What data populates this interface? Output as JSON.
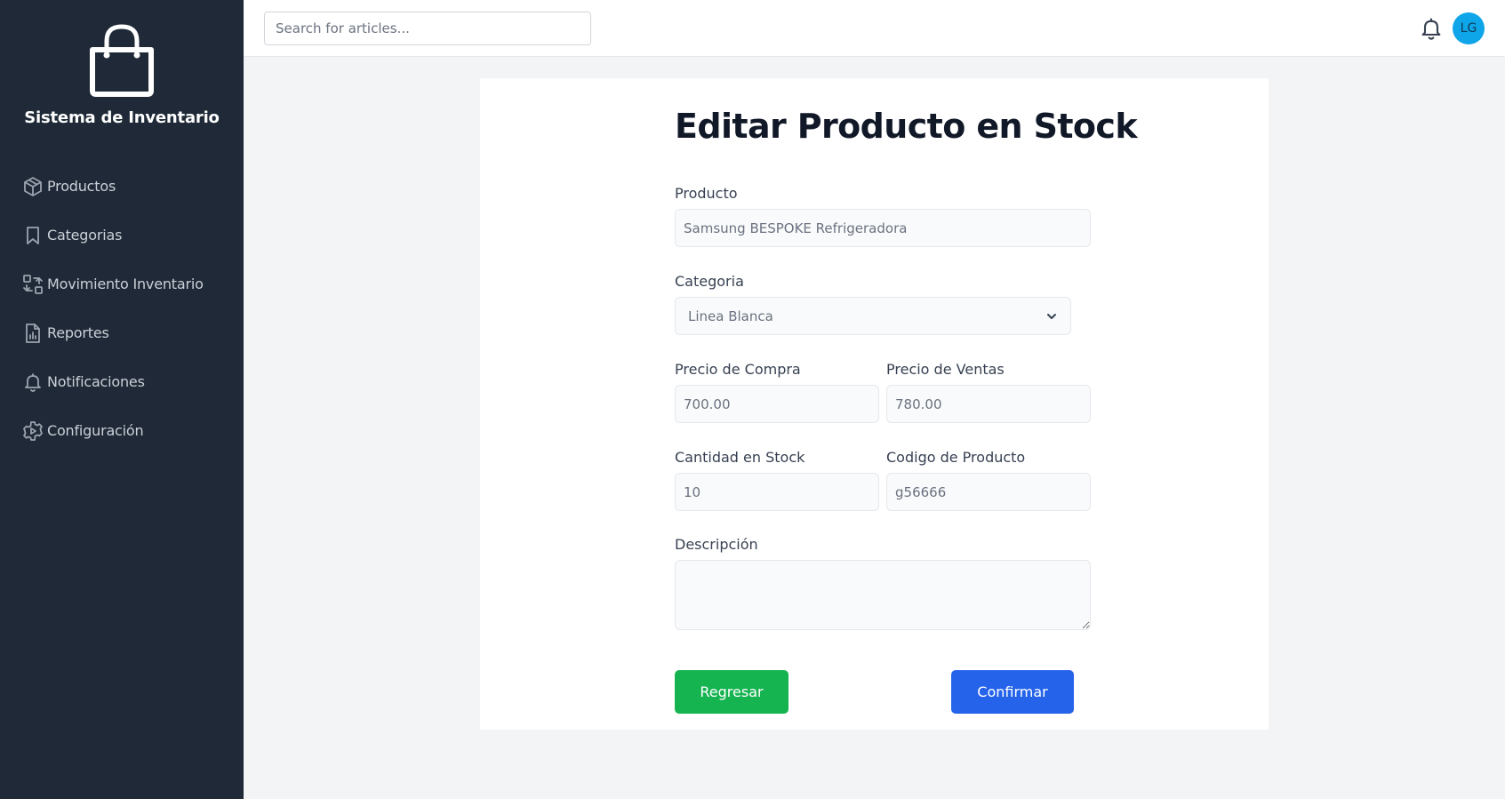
{
  "sidebar": {
    "brand_title": "Sistema de Inventario",
    "brand_icon": "shopping-bag-icon",
    "items": [
      {
        "label": "Productos",
        "icon": "cube-icon"
      },
      {
        "label": "Categorias",
        "icon": "bookmark-icon"
      },
      {
        "label": "Movimiento Inventario",
        "icon": "arrows-exchange-icon"
      },
      {
        "label": "Reportes",
        "icon": "report-file-icon"
      },
      {
        "label": "Notificaciones",
        "icon": "bell-icon"
      },
      {
        "label": "Configuración",
        "icon": "gear-icon"
      }
    ]
  },
  "topbar": {
    "search_placeholder": "Search for articles...",
    "avatar_initials": "LG"
  },
  "form": {
    "title": "Editar Producto en Stock",
    "producto_label": "Producto",
    "producto_value": "Samsung BESPOKE Refrigeradora",
    "categoria_label": "Categoria",
    "categoria_value": "Linea Blanca",
    "precio_compra_label": "Precio de Compra",
    "precio_compra_value": "700.00",
    "precio_ventas_label": "Precio de Ventas",
    "precio_ventas_value": "780.00",
    "cantidad_label": "Cantidad en Stock",
    "cantidad_value": "10",
    "codigo_label": "Codigo de Producto",
    "codigo_value": "g56666",
    "descripcion_label": "Descripción",
    "descripcion_value": "",
    "back_label": "Regresar",
    "confirm_label": "Confirmar"
  },
  "colors": {
    "sidebar_bg": "#1f2937",
    "back_button": "#16b351",
    "confirm_button": "#2563eb",
    "avatar": "#0ea5e9"
  }
}
